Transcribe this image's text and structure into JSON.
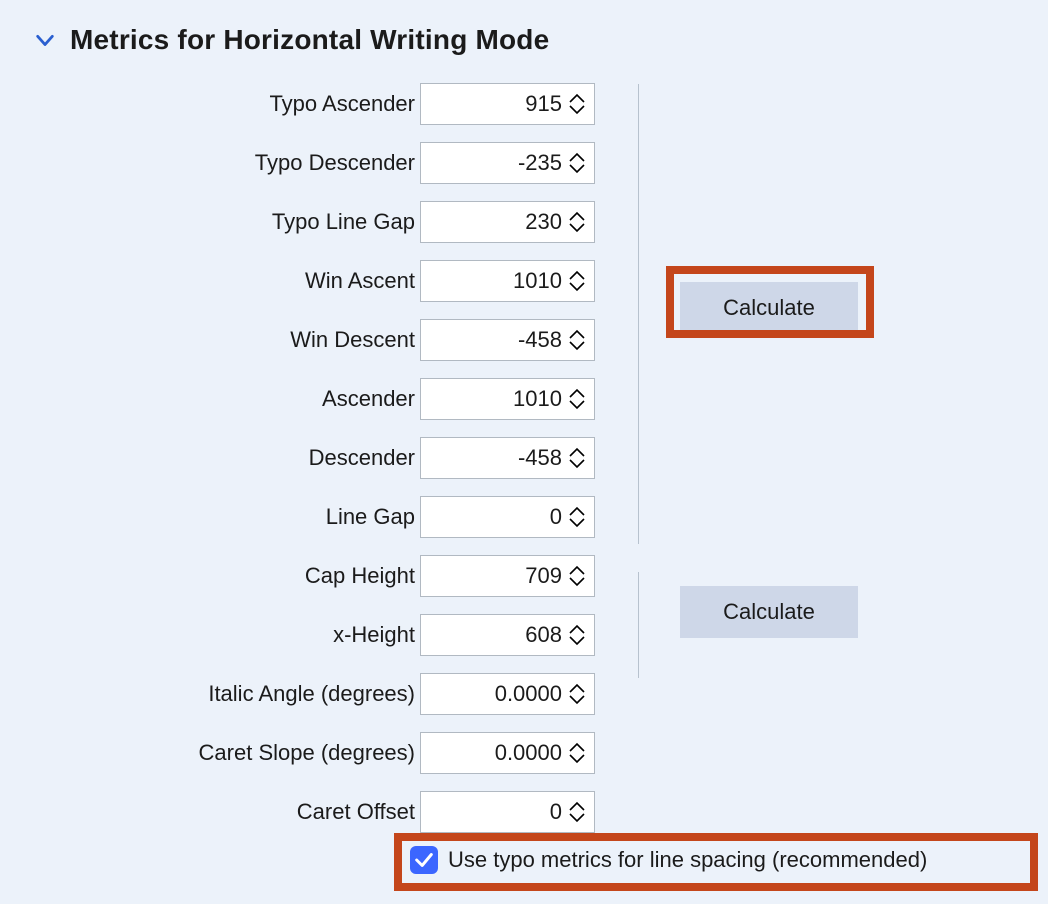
{
  "header": {
    "title": "Metrics for Horizontal Writing Mode",
    "icon": "chevron-down-icon"
  },
  "fields": {
    "typo_ascender": {
      "label": "Typo Ascender",
      "value": "915"
    },
    "typo_descender": {
      "label": "Typo Descender",
      "value": "-235"
    },
    "typo_line_gap": {
      "label": "Typo Line Gap",
      "value": "230"
    },
    "win_ascent": {
      "label": "Win Ascent",
      "value": "1010"
    },
    "win_descent": {
      "label": "Win Descent",
      "value": "-458"
    },
    "ascender": {
      "label": "Ascender",
      "value": "1010"
    },
    "descender": {
      "label": "Descender",
      "value": "-458"
    },
    "line_gap": {
      "label": "Line Gap",
      "value": "0"
    },
    "cap_height": {
      "label": "Cap Height",
      "value": "709"
    },
    "x_height": {
      "label": "x-Height",
      "value": "608"
    },
    "italic_angle": {
      "label": "Italic Angle (degrees)",
      "value": "0.0000"
    },
    "caret_slope": {
      "label": "Caret Slope (degrees)",
      "value": "0.0000"
    },
    "caret_offset": {
      "label": "Caret Offset",
      "value": "0"
    }
  },
  "buttons": {
    "calc1_label": "Calculate",
    "calc2_label": "Calculate"
  },
  "checkbox": {
    "use_typo_label": "Use typo metrics for line spacing (recommended)",
    "checked": true
  }
}
